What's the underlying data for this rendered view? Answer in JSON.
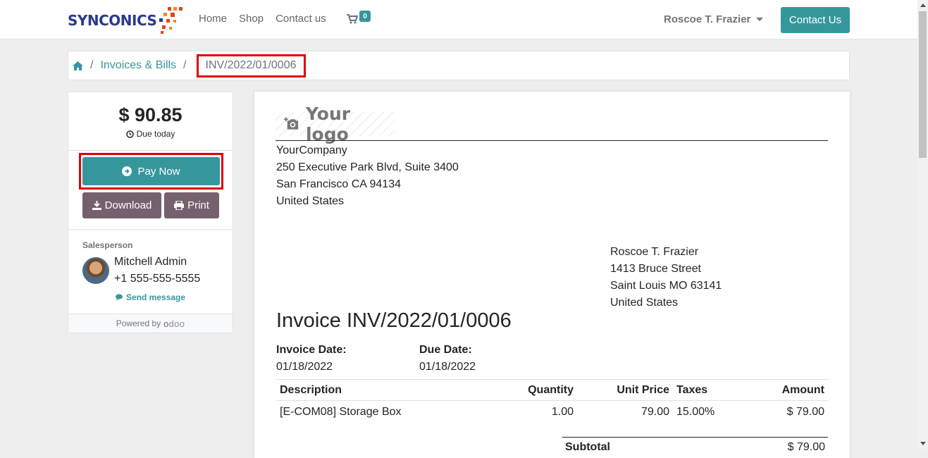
{
  "brand": {
    "name": "SYNCONICS"
  },
  "nav": {
    "links": [
      "Home",
      "Shop",
      "Contact us"
    ],
    "cart_count": "0",
    "user": "Roscoe T. Frazier",
    "contact_button": "Contact Us"
  },
  "breadcrumb": {
    "link": "Invoices & Bills",
    "separator": "/",
    "current": "INV/2022/01/0006"
  },
  "sidebar": {
    "amount": "$ 90.85",
    "due": "Due today",
    "pay_now": "Pay Now",
    "download": "Download",
    "print": "Print",
    "salesperson_label": "Salesperson",
    "salesperson_name": "Mitchell Admin",
    "salesperson_phone": "+1 555-555-5555",
    "send_message": "Send message",
    "powered_by": "Powered by",
    "powered_brand": "odoo"
  },
  "invoice": {
    "logo_text": "Your logo",
    "company_lines": [
      "YourCompany",
      "250 Executive Park Blvd, Suite 3400",
      "San Francisco CA 94134",
      "United States"
    ],
    "partner_lines": [
      "Roscoe T. Frazier",
      "1413 Bruce Street",
      "Saint Louis MO 63141",
      "United States"
    ],
    "title": "Invoice INV/2022/01/0006",
    "invoice_date_label": "Invoice Date:",
    "invoice_date": "01/18/2022",
    "due_date_label": "Due Date:",
    "due_date": "01/18/2022",
    "columns": [
      "Description",
      "Quantity",
      "Unit Price",
      "Taxes",
      "Amount"
    ],
    "lines": [
      {
        "description": "[E-COM08] Storage Box",
        "quantity": "1.00",
        "unit_price": "79.00",
        "taxes": "15.00%",
        "amount": "$ 79.00"
      }
    ],
    "subtotal_label": "Subtotal",
    "subtotal": "$ 79.00"
  },
  "colors": {
    "accent": "#35979c",
    "secondary_button": "#75616e",
    "highlight_border": "#e00000"
  }
}
